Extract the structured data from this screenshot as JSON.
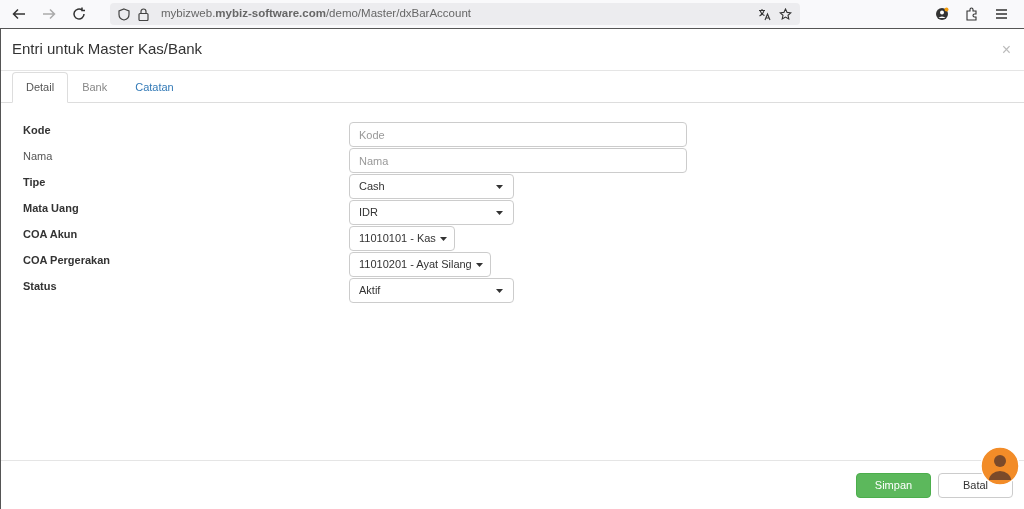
{
  "browser": {
    "url": "mybizweb.**mybiz-software.com**/demo/Master/dxBarAccount"
  },
  "dialog": {
    "title": "Entri untuk Master Kas/Bank",
    "close": "×"
  },
  "tabs": [
    {
      "label": "Detail",
      "selected": true,
      "disabled": false
    },
    {
      "label": "Bank",
      "selected": false,
      "disabled": true
    },
    {
      "label": "Catatan",
      "selected": false,
      "disabled": false
    }
  ],
  "fields": [
    {
      "label": "Kode",
      "required": true,
      "kind": "input",
      "placeholder": "Kode"
    },
    {
      "label": "Nama",
      "required": false,
      "kind": "input",
      "placeholder": "Nama"
    },
    {
      "label": "Tipe",
      "required": true,
      "kind": "select",
      "value": "Cash"
    },
    {
      "label": "Mata Uang",
      "required": true,
      "kind": "select",
      "value": "IDR"
    },
    {
      "label": "COA Akun",
      "required": true,
      "kind": "menu-button",
      "value": "11010101 - Kas"
    },
    {
      "label": "COA Pergerakan",
      "required": true,
      "kind": "menu-button",
      "value": "11010201 - Ayat Silang"
    },
    {
      "label": "Status",
      "required": true,
      "kind": "select",
      "value": "Aktif"
    }
  ],
  "buttons": [
    {
      "label": "Simpan",
      "kind": "primary"
    },
    {
      "label": "Batal",
      "kind": "default"
    }
  ]
}
